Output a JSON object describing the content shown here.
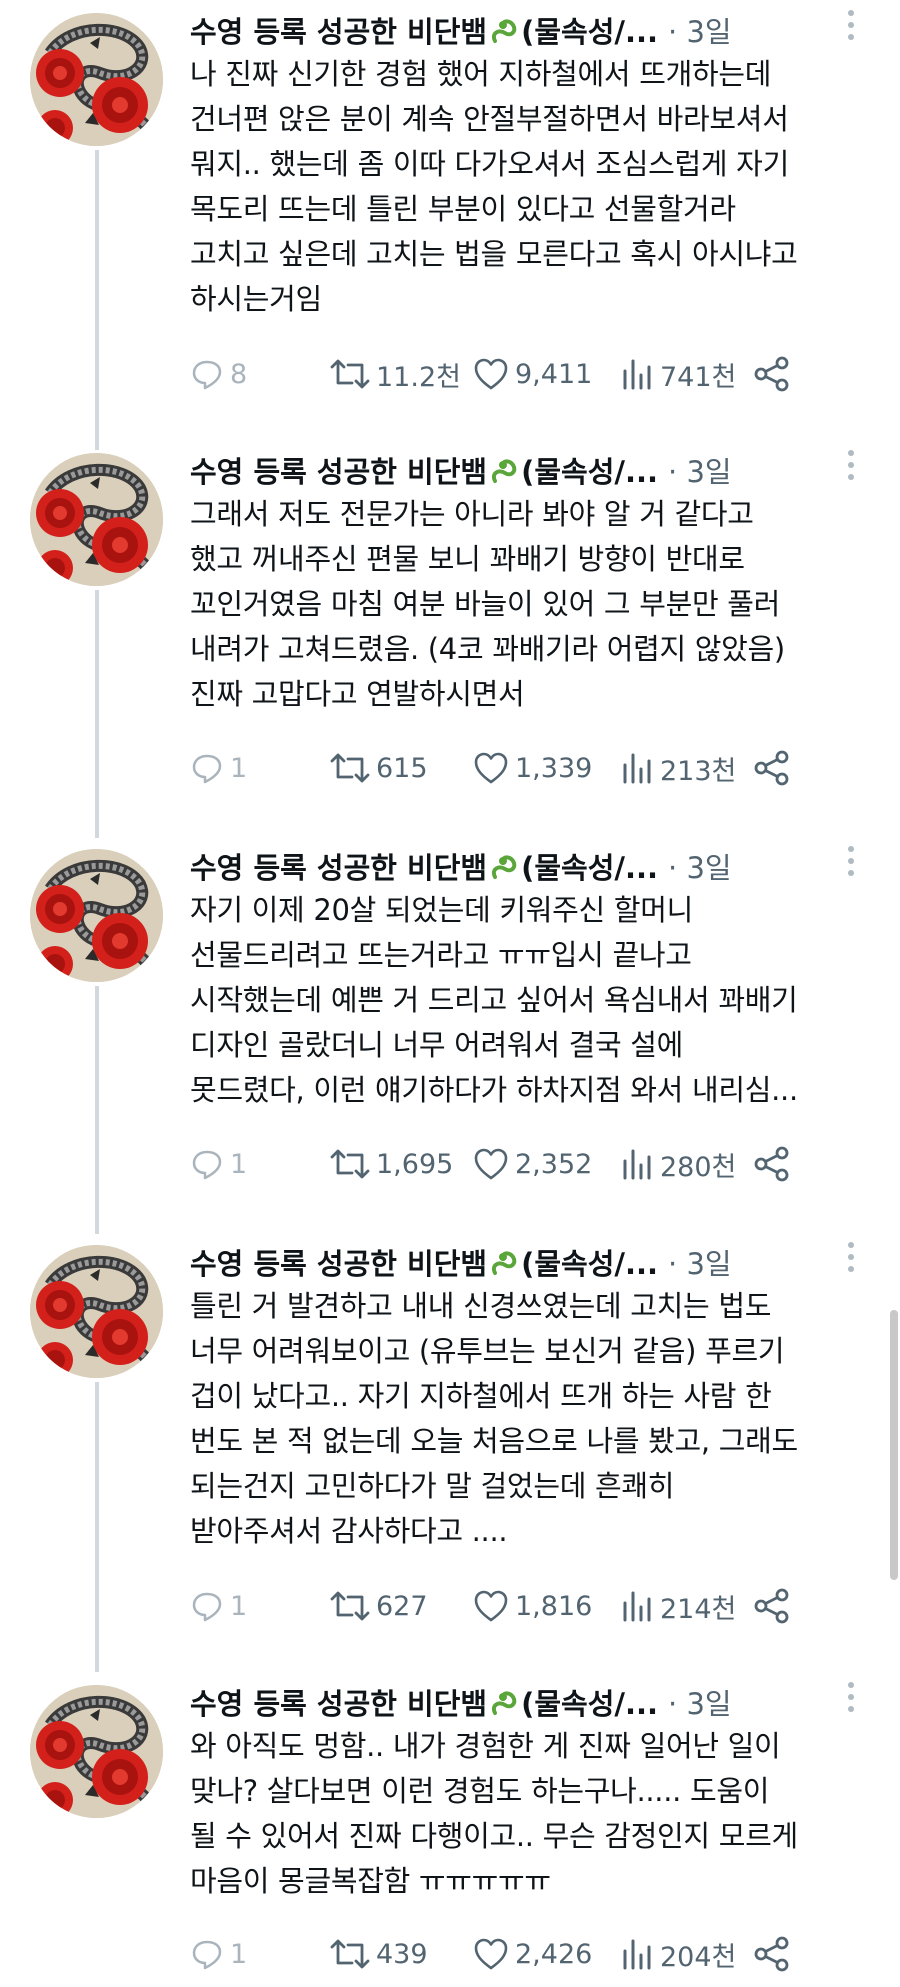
{
  "thread": {
    "author_name": "수영 등록 성공한 비단뱀",
    "author_name_suffix": "(물속성/...",
    "separator": "·",
    "posts": [
      {
        "time": "3일",
        "text": "나 진짜 신기한 경험 했어 지하철에서 뜨개하는데\n건너편 앉은 분이 계속 안절부절하면서 바라보셔서\n뭐지.. 했는데 좀 이따 다가오셔서 조심스럽게 자기\n목도리 뜨는데 틀린 부분이 있다고 선물할거라\n고치고 싶은데 고치는 법을 모른다고 혹시 아시냐고\n하시는거임",
        "replies": "8",
        "reposts": "11.2천",
        "likes": "9,411",
        "views": "741천"
      },
      {
        "time": "3일",
        "text": "그래서 저도 전문가는 아니라 봐야 알 거 같다고\n했고 꺼내주신 편물 보니 꽈배기 방향이 반대로\n꼬인거였음 마침 여분 바늘이 있어 그 부분만 풀러\n내려가 고쳐드렸음. (4코 꽈배기라 어렵지 않았음)\n진짜 고맙다고 연발하시면서",
        "replies": "1",
        "reposts": "615",
        "likes": "1,339",
        "views": "213천"
      },
      {
        "time": "3일",
        "text": "자기 이제 20살 되었는데 키워주신 할머니\n선물드리려고 뜨는거라고 ㅠㅠ입시 끝나고\n시작했는데 예쁜 거 드리고 싶어서 욕심내서 꽈배기\n디자인 골랐더니 너무 어려워서 결국 설에\n못드렸다, 이런 얘기하다가 하차지점 와서 내리심...",
        "replies": "1",
        "reposts": "1,695",
        "likes": "2,352",
        "views": "280천"
      },
      {
        "time": "3일",
        "text": "틀린 거 발견하고 내내 신경쓰였는데 고치는 법도\n너무 어려워보이고 (유투브는 보신거 같음) 푸르기\n겁이 났다고.. 자기 지하철에서 뜨개 하는 사람 한\n번도 본 적 없는데 오늘 처음으로 나를 봤고, 그래도\n되는건지 고민하다가 말 걸었는데 흔쾌히\n받아주셔서 감사하다고 ....",
        "replies": "1",
        "reposts": "627",
        "likes": "1,816",
        "views": "214천"
      },
      {
        "time": "3일",
        "text": "와 아직도 멍함.. 내가 경험한 게 진짜 일어난 일이\n맞나? 살다보면 이런 경험도 하는구나..... 도움이\n될 수 있어서 진짜 다행이고.. 무슨 감정인지 모르게\n마음이 몽글복잡함 ㅠㅠㅠㅠㅠ",
        "replies": "1",
        "reposts": "439",
        "likes": "2,426",
        "views": "204천"
      }
    ]
  },
  "icons": {
    "reply": "reply-icon",
    "repost": "repost-icon",
    "like": "heart-icon",
    "views": "views-icon",
    "share": "share-icon",
    "more": "more-icon",
    "snake_emoji": "snake-icon"
  },
  "colors": {
    "text": "#0f1419",
    "secondary": "#536471",
    "thread_line": "#cfd9de",
    "avatar_bg": "#d9cfba",
    "avatar_flower": "#d3201a"
  }
}
